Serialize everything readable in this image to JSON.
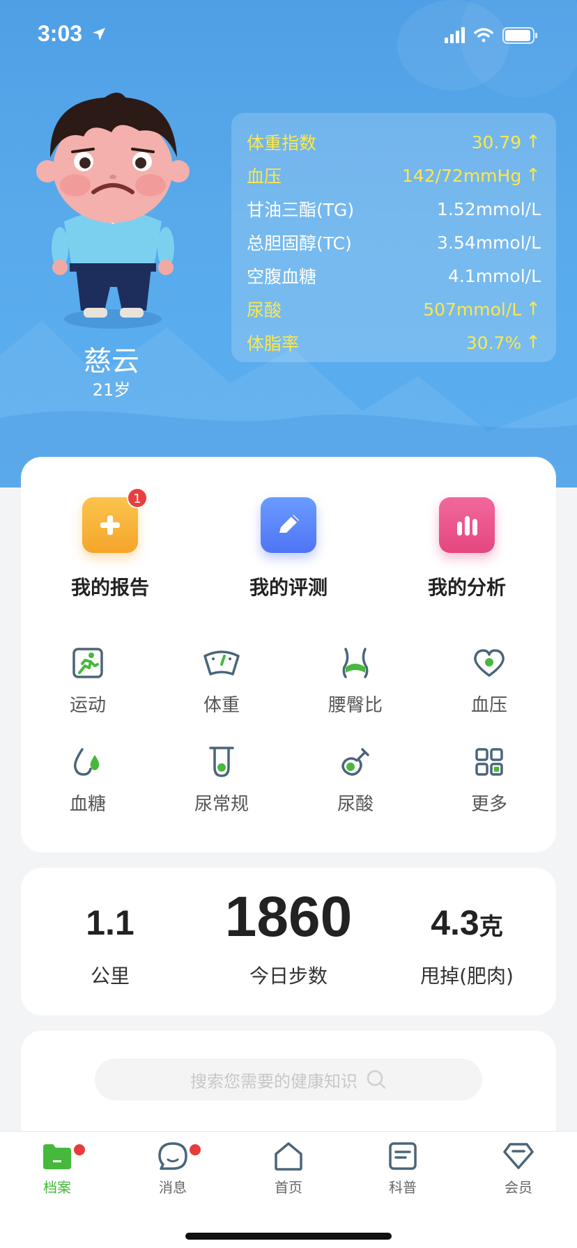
{
  "status": {
    "time": "3:03"
  },
  "user": {
    "name": "慈云",
    "age": "21岁"
  },
  "metrics": [
    {
      "label": "体重指数",
      "value": "30.79",
      "warn": true
    },
    {
      "label": "血压",
      "value": "142/72mmHg",
      "warn": true
    },
    {
      "label": "甘油三酯(TG)",
      "value": "1.52mmol/L",
      "warn": false
    },
    {
      "label": "总胆固醇(TC)",
      "value": "3.54mmol/L",
      "warn": false
    },
    {
      "label": "空腹血糖",
      "value": "4.1mmol/L",
      "warn": false
    },
    {
      "label": "尿酸",
      "value": "507mmol/L",
      "warn": true
    },
    {
      "label": "体脂率",
      "value": "30.7%",
      "warn": true
    }
  ],
  "arrow_up": "↑",
  "tiles": [
    {
      "label": "我的报告",
      "badge": "1",
      "icon": "report-plus-icon"
    },
    {
      "label": "我的评测",
      "icon": "pencil-icon"
    },
    {
      "label": "我的分析",
      "icon": "bar-chart-icon"
    }
  ],
  "grid": [
    {
      "label": "运动",
      "icon": "running-icon"
    },
    {
      "label": "体重",
      "icon": "scale-icon"
    },
    {
      "label": "腰臀比",
      "icon": "waist-hip-icon"
    },
    {
      "label": "血压",
      "icon": "heart-icon"
    },
    {
      "label": "血糖",
      "icon": "drop-icon"
    },
    {
      "label": "尿常规",
      "icon": "test-tube-icon"
    },
    {
      "label": "尿酸",
      "icon": "flask-icon"
    },
    {
      "label": "更多",
      "icon": "grid-more-icon"
    }
  ],
  "steps": {
    "distance_value": "1.1",
    "distance_label": "公里",
    "steps_value": "1860",
    "steps_label": "今日步数",
    "fat_value": "4.3",
    "fat_unit": "克",
    "fat_label": "甩掉(肥肉)"
  },
  "search": {
    "placeholder": "搜索您需要的健康知识"
  },
  "tabs": [
    {
      "label": "档案",
      "active": true
    },
    {
      "label": "消息"
    },
    {
      "label": "首页"
    },
    {
      "label": "科普"
    },
    {
      "label": "会员"
    }
  ],
  "colors": {
    "accent_green": "#46b83c",
    "warn_yellow": "#fde84a",
    "hero_blue": "#58aaeb"
  }
}
